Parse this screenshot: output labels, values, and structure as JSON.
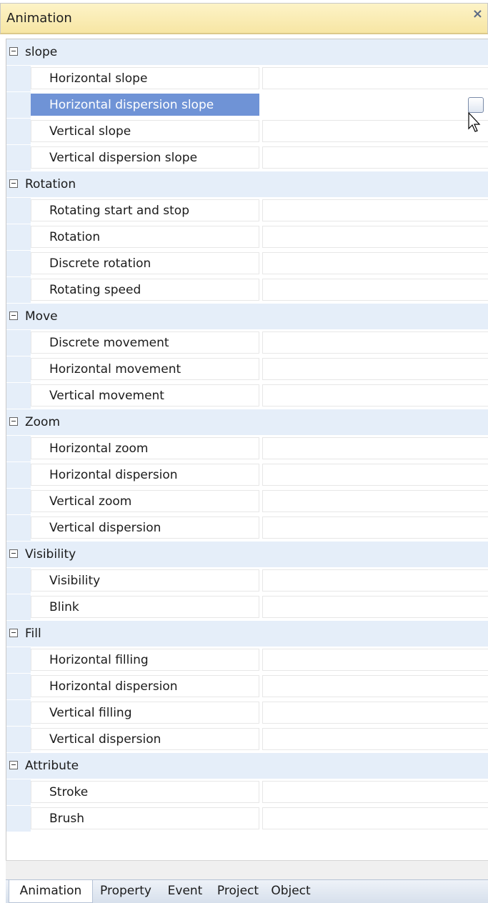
{
  "panel": {
    "title": "Animation",
    "close_glyph": "×"
  },
  "groups": [
    {
      "label": "slope",
      "items": [
        "Horizontal slope",
        "Horizontal dispersion slope",
        "Vertical slope",
        "Vertical dispersion slope"
      ]
    },
    {
      "label": "Rotation",
      "items": [
        "Rotating start and stop",
        "Rotation",
        "Discrete rotation",
        "Rotating speed"
      ]
    },
    {
      "label": "Move",
      "items": [
        "Discrete movement",
        "Horizontal movement",
        "Vertical movement"
      ]
    },
    {
      "label": "Zoom",
      "items": [
        "Horizontal zoom",
        "Horizontal dispersion",
        "Vertical zoom",
        "Vertical dispersion"
      ]
    },
    {
      "label": "Visibility",
      "items": [
        "Visibility",
        "Blink"
      ]
    },
    {
      "label": "Fill",
      "items": [
        "Horizontal filling",
        "Horizontal dispersion",
        "Vertical filling",
        "Vertical dispersion"
      ]
    },
    {
      "label": "Attribute",
      "items": [
        "Stroke",
        "Brush"
      ]
    }
  ],
  "selected": {
    "group": 0,
    "item": 1
  },
  "tabs": [
    "Animation",
    "Property",
    "Event",
    "Project",
    "Object"
  ],
  "active_tab": 0,
  "icons": {
    "collapse": "minus-box-icon",
    "edit": "ellipsis-button-icon",
    "cursor": "mouse-pointer-icon"
  },
  "colors": {
    "selection": "#6f93d6",
    "category_bg": "#e5eef9",
    "title_bg": "#f7e6a4"
  }
}
